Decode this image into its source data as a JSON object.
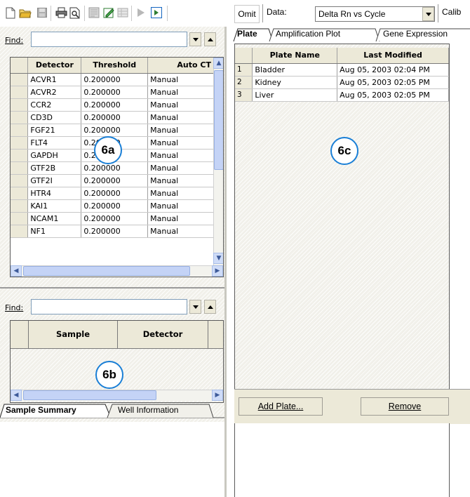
{
  "toolbar": {
    "omit_label": "Omit",
    "data_label": "Data:",
    "data_value": "Delta Rn vs Cycle",
    "calib_label": "Calib"
  },
  "left_panel": {
    "find_label": "Find:",
    "detector_table": {
      "columns": [
        "Detector",
        "Threshold",
        "Auto CT"
      ],
      "rows": [
        [
          "ACVR1",
          "0.200000",
          "Manual"
        ],
        [
          "ACVR2",
          "0.200000",
          "Manual"
        ],
        [
          "CCR2",
          "0.200000",
          "Manual"
        ],
        [
          "CD3D",
          "0.200000",
          "Manual"
        ],
        [
          "FGF21",
          "0.200000",
          "Manual"
        ],
        [
          "FLT4",
          "0.200000",
          "Manual"
        ],
        [
          "GAPDH",
          "0.200000",
          "Manual"
        ],
        [
          "GTF2B",
          "0.200000",
          "Manual"
        ],
        [
          "GTF2I",
          "0.200000",
          "Manual"
        ],
        [
          "HTR4",
          "0.200000",
          "Manual"
        ],
        [
          "KAI1",
          "0.200000",
          "Manual"
        ],
        [
          "NCAM1",
          "0.200000",
          "Manual"
        ],
        [
          "NF1",
          "0.200000",
          "Manual"
        ]
      ]
    },
    "sample_find_label": "Find:",
    "sample_table": {
      "columns": [
        "Sample",
        "Detector"
      ]
    },
    "tabs": [
      "Sample Summary",
      "Well Information"
    ]
  },
  "right_panel": {
    "tabs": [
      "Plate",
      "Amplification Plot",
      "Gene Expression"
    ],
    "plate_table": {
      "columns": [
        "Plate Name",
        "Last Modified"
      ],
      "rows": [
        {
          "index": "1",
          "name": "Bladder",
          "modified": "Aug 05, 2003 02:04 PM"
        },
        {
          "index": "2",
          "name": "Kidney",
          "modified": "Aug 05, 2003 02:05 PM"
        },
        {
          "index": "3",
          "name": "Liver",
          "modified": "Aug 05, 2003 02:05 PM"
        }
      ]
    },
    "add_plate_label": "Add Plate...",
    "remove_label": "Remove"
  },
  "callouts": {
    "a": "6a",
    "b": "6b",
    "c": "6c"
  }
}
